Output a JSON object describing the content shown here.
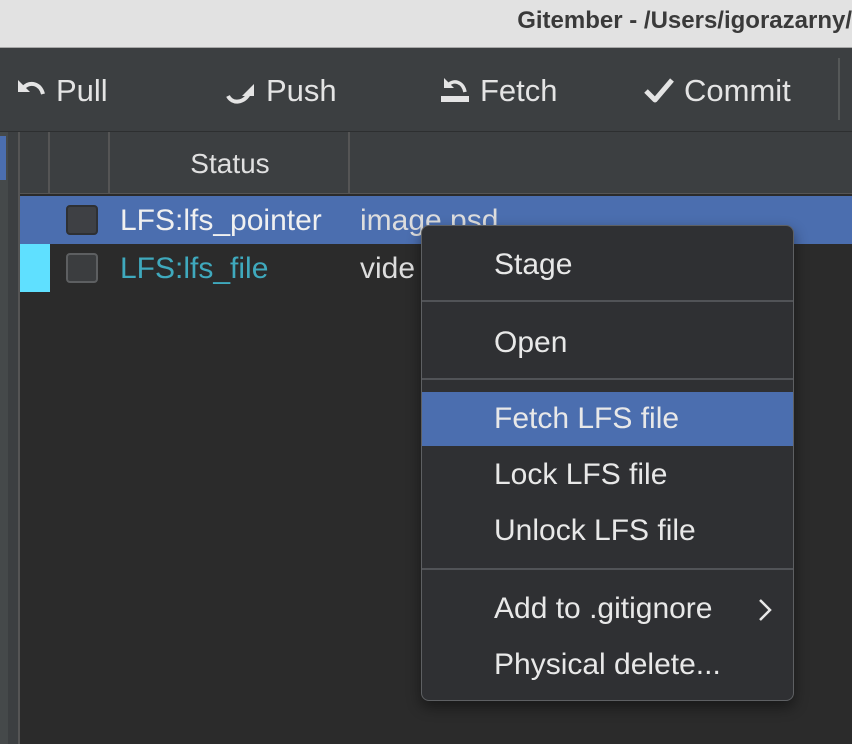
{
  "window": {
    "title": "Gitember - /Users/igorazarny/"
  },
  "toolbar": {
    "pull_label": "Pull",
    "push_label": "Push",
    "fetch_label": "Fetch",
    "commit_label": "Commit"
  },
  "table": {
    "columns": [
      "",
      "",
      "Status",
      ""
    ],
    "rows": [
      {
        "status": "LFS:lfs_pointer",
        "file": "image.psd",
        "selected": true,
        "checked": false
      },
      {
        "status": "LFS:lfs_file",
        "file": "vide",
        "selected": false,
        "checked": false,
        "marker_color": "#5fe0ff"
      }
    ]
  },
  "context_menu": {
    "items": [
      {
        "label": "Stage"
      },
      {
        "label": "Open"
      },
      {
        "label": "Fetch LFS file",
        "highlighted": true
      },
      {
        "label": "Lock LFS file"
      },
      {
        "label": "Unlock LFS file"
      },
      {
        "label": "Add  to .gitignore",
        "submenu": true
      },
      {
        "label": "Physical delete..."
      }
    ]
  },
  "colors": {
    "selection": "#4b6eaf",
    "lfs_file_status": "#3fa9bd",
    "background": "#3c3f41"
  }
}
